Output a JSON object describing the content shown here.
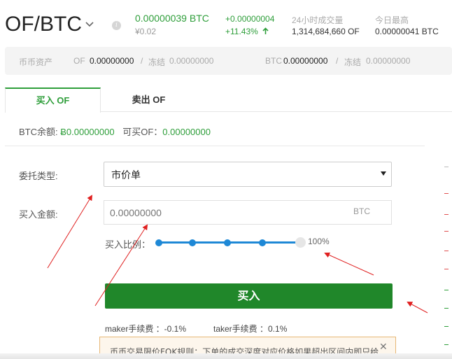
{
  "header": {
    "pair": "OF/BTC",
    "price": "0.00000039 BTC",
    "price_cny": "¥0.02",
    "change": "+0.00000004",
    "change_pct": "+11.43%",
    "volume_label": "24小时成交量",
    "volume_value": "1,314,684,660 OF",
    "high_label": "今日最高",
    "high_value": "0.00000041 BTC"
  },
  "assets": {
    "title": "币币资产",
    "of_currency": "OF",
    "of_available": "0.00000000",
    "of_sep": "/",
    "of_frozen_label": "冻结",
    "of_frozen": "0.00000000",
    "btc_currency": "BTC",
    "btc_available": "0.00000000",
    "btc_sep": "/",
    "btc_frozen_label": "冻结",
    "btc_frozen": "0.00000000"
  },
  "tabs": [
    {
      "label": "买入 OF",
      "active": true
    },
    {
      "label": "卖出 OF",
      "active": false
    }
  ],
  "balance": {
    "btc_label": "BTC余额: ",
    "btc_value": "Ƀ0.00000000",
    "can_buy_label": "可买OF：",
    "can_buy_value": "0.00000000"
  },
  "form": {
    "order_type_label": "委托类型:",
    "order_type_value": "市价单",
    "amount_label": "买入金额:",
    "amount_placeholder": "0.00000000",
    "amount_unit": "BTC",
    "ratio_label": "买入比例：",
    "ratio_value": "100%",
    "ratio_level": 1.0,
    "buy_button": "买入"
  },
  "fees": {
    "maker": "maker手续费 ：-0.1%",
    "taker": "taker手续费 ：0.1%"
  },
  "notice": {
    "text": "币币交易限价FOK规则：下单的成交深度对应价格如果超出区间内即只给",
    "close": "✕"
  },
  "colors": {
    "accent": "#2e9e3a",
    "buy_button": "#20872a",
    "slider": "#1e88d6",
    "annotation_arrow": "#e02020"
  }
}
